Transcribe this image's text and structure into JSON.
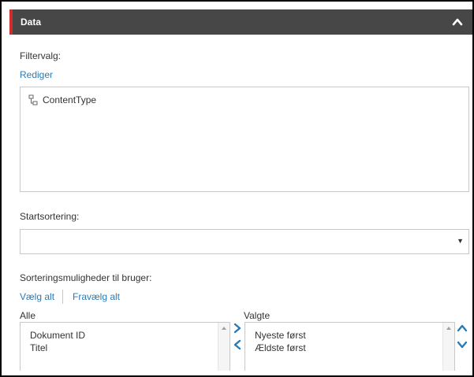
{
  "header": {
    "title": "Data"
  },
  "filter": {
    "label": "Filtervalg:",
    "edit_link": "Rediger",
    "tree_item": "ContentType"
  },
  "sort": {
    "label": "Startsortering:",
    "value": ""
  },
  "user_sort": {
    "label": "Sorteringsmuligheder til bruger:",
    "select_all": "Vælg alt",
    "deselect_all": "Fravælg alt",
    "available_label": "Alle",
    "available_items": [
      "Dokument ID",
      "Titel"
    ],
    "selected_label": "Valgte",
    "selected_items": [
      "Nyeste først",
      "Ældste først"
    ]
  },
  "colors": {
    "header_bg": "#474747",
    "accent": "#d22b2b",
    "link": "#2a7ab5",
    "arrow": "#2a7ab5"
  },
  "icons": {
    "collapse": "chevron-up-icon",
    "tree": "hierarchy-icon",
    "caret": "dropdown-caret",
    "add": "chevron-right-icon",
    "remove": "chevron-left-icon",
    "move_up": "chevron-up-icon",
    "move_down": "chevron-down-icon"
  }
}
